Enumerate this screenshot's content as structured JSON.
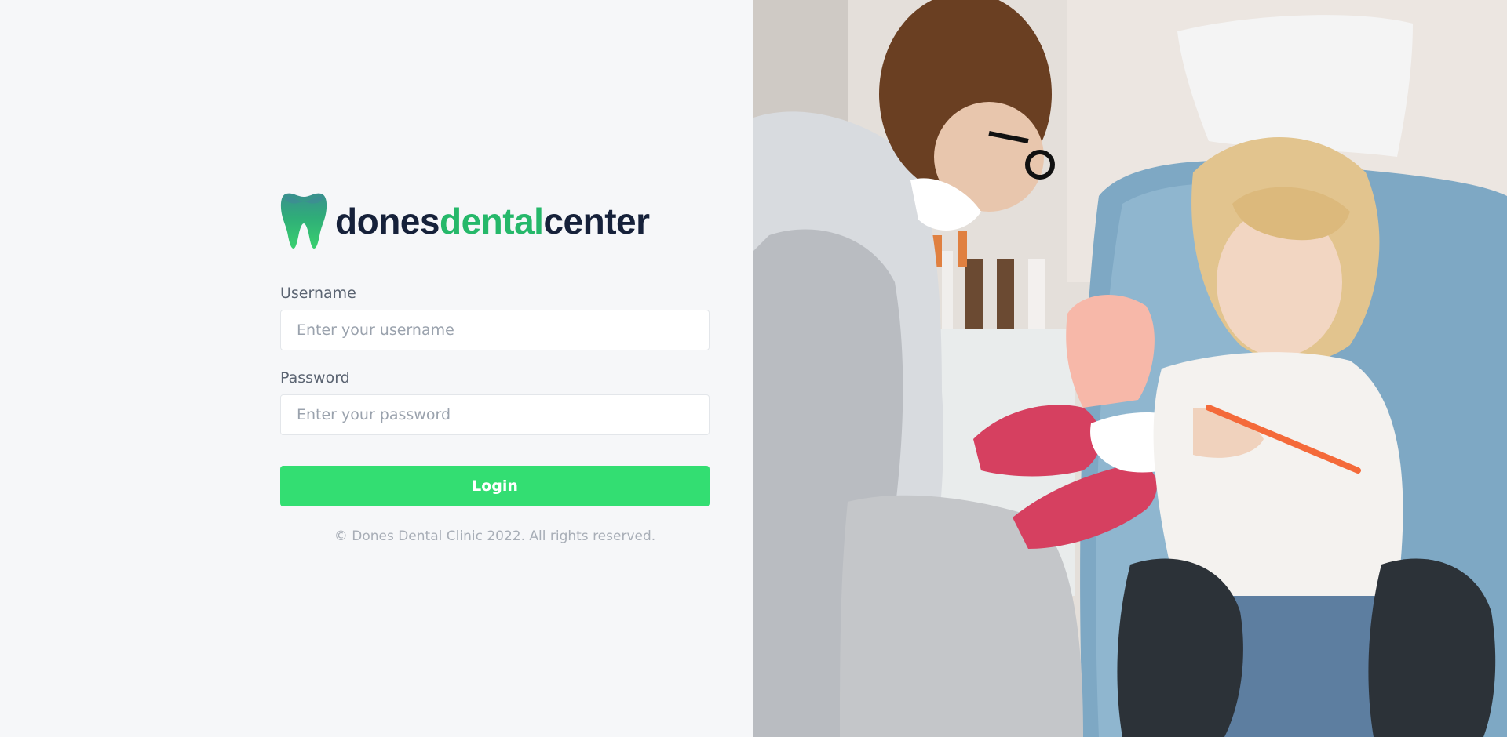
{
  "brand": {
    "part1": "dones",
    "part2": "dental",
    "part3": "center",
    "logo_icon": "tooth-icon",
    "colors": {
      "dark": "#16213a",
      "green": "#25b86a"
    }
  },
  "form": {
    "username_label": "Username",
    "username_placeholder": "Enter your username",
    "username_value": "",
    "password_label": "Password",
    "password_placeholder": "Enter your password",
    "password_value": "",
    "login_label": "Login",
    "login_color": "#33de72"
  },
  "footer": {
    "copyright": "© Dones Dental Clinic 2022. All rights reserved."
  },
  "hero_image": {
    "icon": "dentist-photo"
  }
}
